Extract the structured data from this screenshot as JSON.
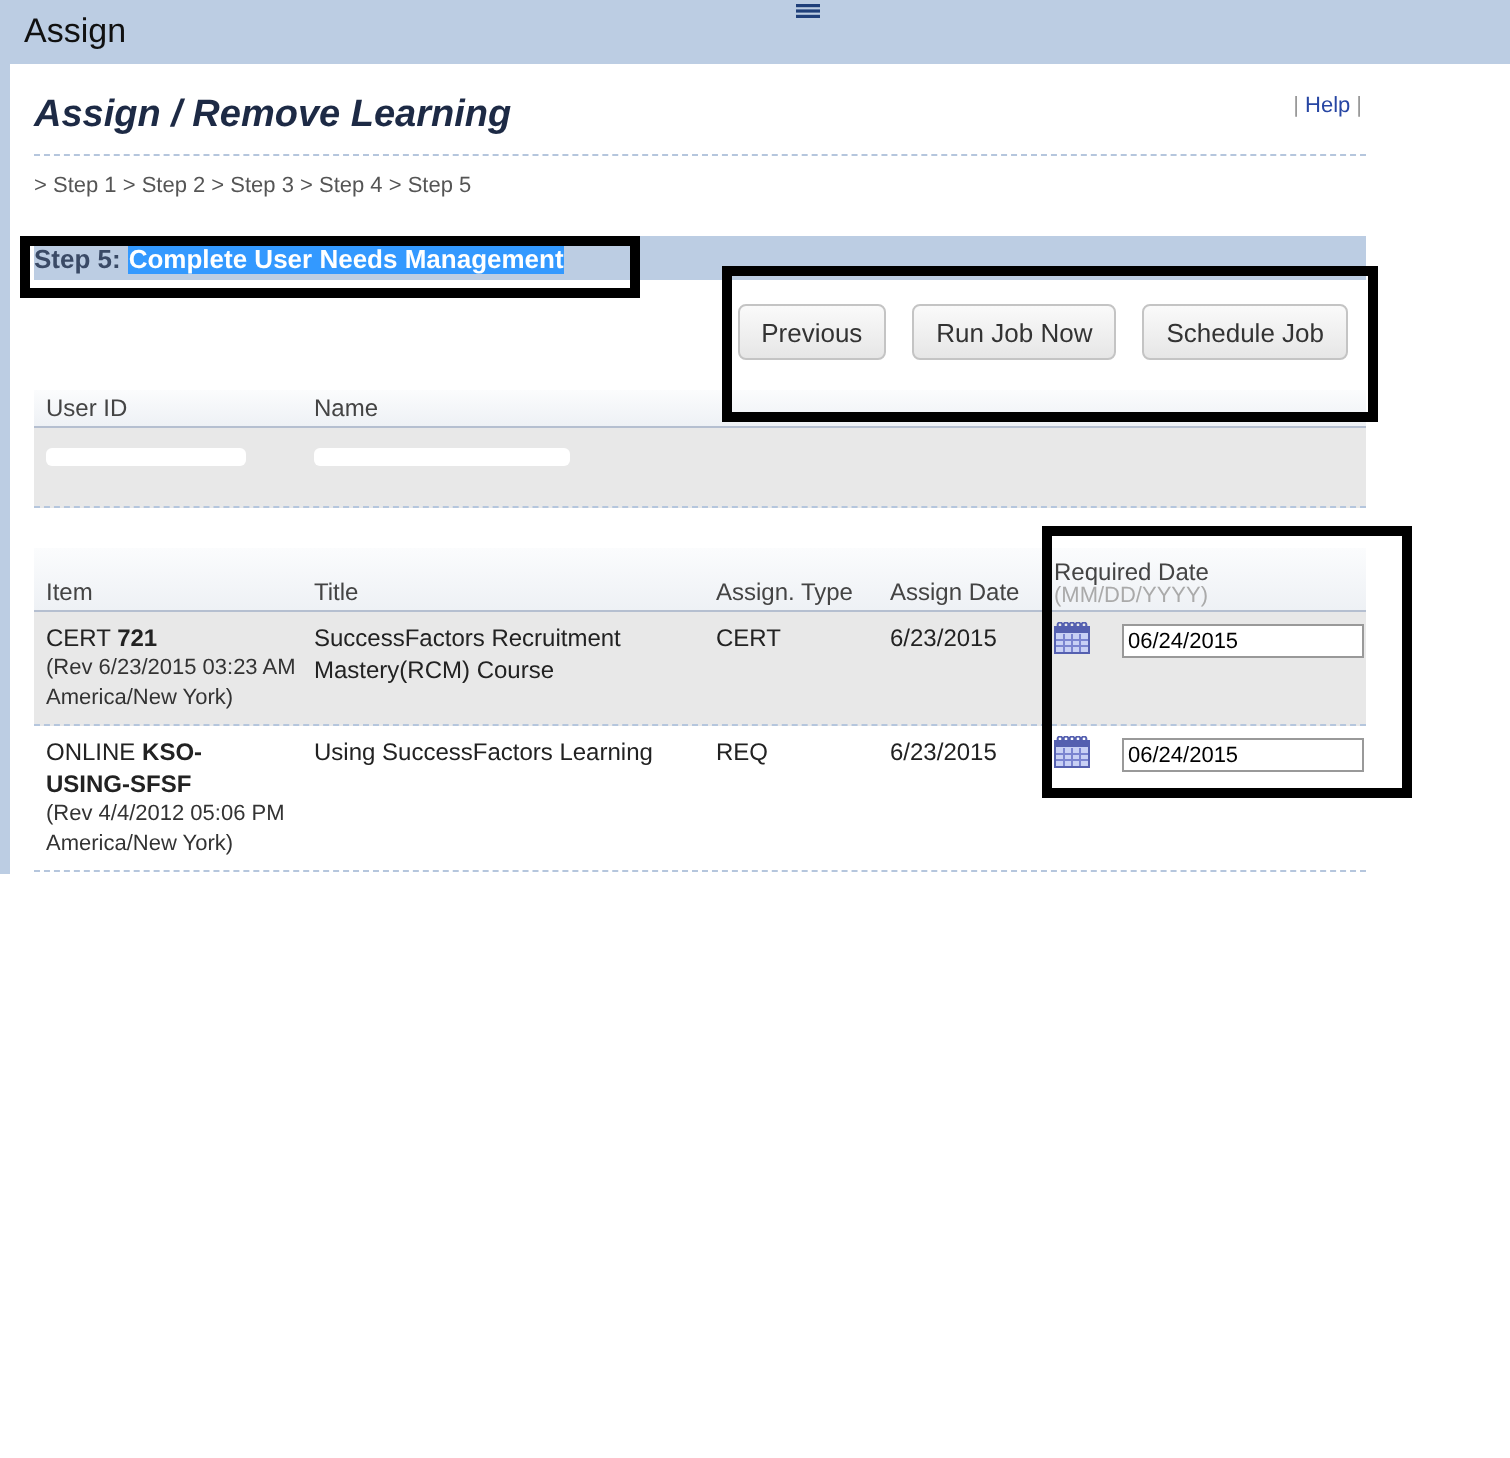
{
  "window": {
    "title": "Assign"
  },
  "page": {
    "title": "Assign / Remove Learning",
    "help_link": "Help",
    "help_separator_left": "|",
    "help_separator_right": "|"
  },
  "breadcrumb": "> Step 1 > Step 2 > Step 3 > Step 4 > Step 5",
  "step_heading": {
    "label": "Step 5:",
    "title": "Complete User Needs Management",
    "title_selected": true,
    "annotated": true
  },
  "buttons_annotated": true,
  "buttons": [
    "Previous",
    "Run Job Now",
    "Schedule Job"
  ],
  "users_table": {
    "columns": [
      "User ID",
      "Name"
    ],
    "rows": [
      {
        "redacted": true
      }
    ]
  },
  "items_table": {
    "columns": [
      "Item",
      "Title",
      "Assign. Type",
      "Assign Date",
      "Required Date"
    ],
    "date_hint": "(MM/DD/YYYY)",
    "required_date_annotated": true,
    "rows": [
      {
        "item_type": "CERT",
        "item_id": "721",
        "revision": "(Rev 6/23/2015 03:23 AM America/New York)",
        "title": "SuccessFactors Recruitment Mastery(RCM) Course",
        "assign_type": "CERT",
        "assign_date": "6/23/2015",
        "required_date": "06/24/2015",
        "shaded": true
      },
      {
        "item_type": "ONLINE",
        "item_id": "KSO-USING-SFSF",
        "revision": "(Rev 4/4/2012 05:06 PM America/New York)",
        "title": "Using SuccessFactors Learning",
        "assign_type": "REQ",
        "assign_date": "6/23/2015",
        "required_date": "06/24/2015",
        "shaded": false
      }
    ]
  }
}
